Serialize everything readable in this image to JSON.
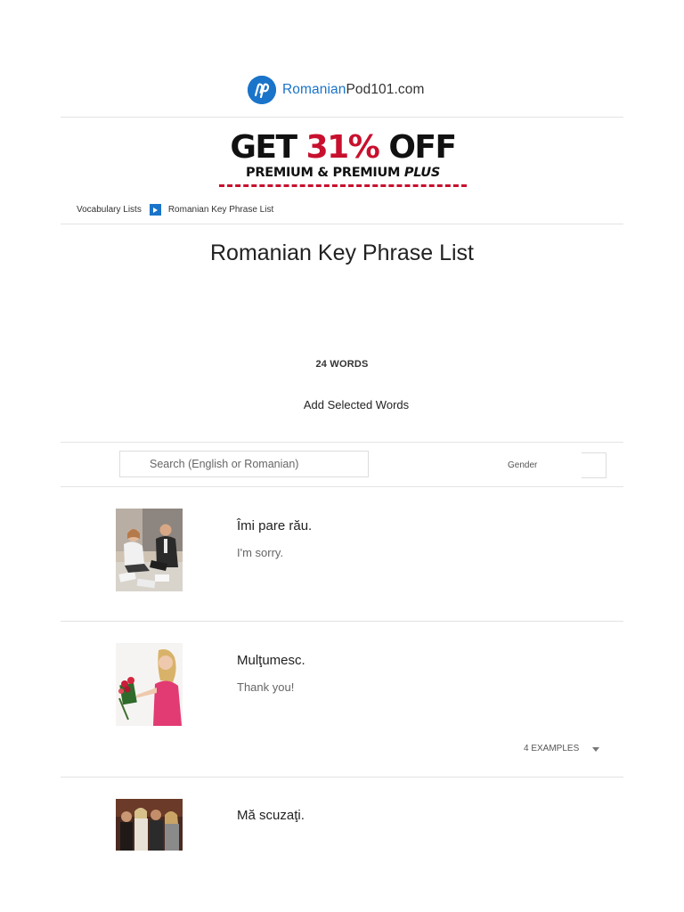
{
  "header": {
    "logo_icon": "romanianpod101-logo-icon",
    "logo_text_brand": "Romanian",
    "logo_text_rest": "Pod101.com",
    "brand_color": "#1a74c9"
  },
  "promo": {
    "line1_prefix": "GET",
    "line1_highlight": "31%",
    "line1_suffix": "OFF",
    "line2_prefix": "PREMIUM & PREMIUM",
    "line2_emphasis": "PLUS",
    "accent_color": "#c8102e"
  },
  "breadcrumb": {
    "items": [
      "Vocabulary Lists",
      "Romanian Key Phrase List"
    ],
    "separator_icon": "play-arrow-icon"
  },
  "page": {
    "title": "Romanian Key Phrase List",
    "word_count": "24 WORDS",
    "add_selected_label": "Add Selected Words"
  },
  "filters": {
    "search_placeholder": "Search (English or Romanian)",
    "gender_label": "Gender"
  },
  "words": [
    {
      "romanian": "Îmi pare rău.",
      "english": "I'm sorry.",
      "image": "office-couple-sitting-floor-photo"
    },
    {
      "romanian": "Mulţumesc.",
      "english": "Thank you!",
      "image": "woman-holding-flowers-photo",
      "examples_label": "4 EXAMPLES"
    },
    {
      "romanian": "Mă scuzaţi.",
      "english": "",
      "image": "group-of-people-photo"
    }
  ]
}
